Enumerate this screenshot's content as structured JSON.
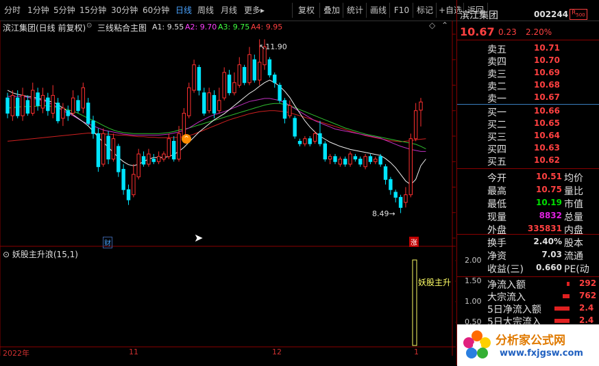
{
  "toolbar": {
    "periods": [
      "分时",
      "1分钟",
      "5分钟",
      "15分钟",
      "30分钟",
      "60分钟",
      "日线",
      "周线",
      "月线",
      "更多"
    ],
    "active_period": "日线",
    "more_arrow": "▸",
    "buttons": [
      "复权",
      "叠加",
      "统计",
      "画线",
      "F10",
      "标记",
      "+自选",
      "返回"
    ]
  },
  "chart_header": {
    "stock_title": "滨江集团(日线 前复权)",
    "indicator_name": "三线粘合主图",
    "a1": "A1: 9.55",
    "a2": "A2: 9.70",
    "a3": "A3: 9.75",
    "a4": "A4: 9.95"
  },
  "annotations": {
    "high": "11.90",
    "low": "8.49",
    "cai_badge": "财",
    "zhang_badge": "涨"
  },
  "sub_panel": {
    "title": "妖股主升浪(15,1)",
    "signal_text": "妖股主升",
    "ticks": [
      "2.00",
      "1.50",
      "1.00",
      "0.50"
    ]
  },
  "date_axis": [
    "2022年",
    "11",
    "12",
    "1"
  ],
  "quote": {
    "name": "滨江集团",
    "code": "002244",
    "badge": "R",
    "badge_num": "500",
    "price": "10.67",
    "change": "0.23",
    "pct": "2.20%",
    "asks": [
      {
        "label": "卖五",
        "price": "10.71"
      },
      {
        "label": "卖四",
        "price": "10.70"
      },
      {
        "label": "卖三",
        "price": "10.69"
      },
      {
        "label": "卖二",
        "price": "10.68"
      },
      {
        "label": "卖一",
        "price": "10.67"
      }
    ],
    "bids": [
      {
        "label": "买一",
        "price": "10.66"
      },
      {
        "label": "买二",
        "price": "10.65"
      },
      {
        "label": "买三",
        "price": "10.64"
      },
      {
        "label": "买四",
        "price": "10.63"
      },
      {
        "label": "买五",
        "price": "10.62"
      }
    ],
    "stats": [
      {
        "k": "今开",
        "v": "10.51",
        "k2": "均价",
        "color": "#ff4040"
      },
      {
        "k": "最高",
        "v": "10.75",
        "k2": "量比",
        "color": "#ff4040"
      },
      {
        "k": "最低",
        "v": "10.19",
        "k2": "市值",
        "color": "#00e000"
      },
      {
        "k": "现量",
        "v": "8832",
        "k2": "总量",
        "color": "#e020e0"
      },
      {
        "k": "外盘",
        "v": "335831",
        "k2": "内盘",
        "color": "#ff4040"
      }
    ],
    "stats2": [
      {
        "k": "换手",
        "v": "2.40%",
        "k2": "股本"
      },
      {
        "k": "净资",
        "v": "7.03",
        "k2": "流通"
      },
      {
        "k": "收益(三)",
        "v": "0.660",
        "k2": "PE(动"
      }
    ],
    "flows": [
      {
        "k": "净流入额",
        "v": "292"
      },
      {
        "k": "大宗流入",
        "v": "762"
      },
      {
        "k": "5日净流入额",
        "v": "2.4"
      },
      {
        "k": "5日大宗流入",
        "v": "2.4"
      }
    ]
  },
  "watermark": {
    "title": "分析家公式网",
    "url": "www.fxjgsw.com"
  },
  "chart_data": {
    "type": "candlestick",
    "yticks": [
      "12.00",
      "11.50",
      "11.00",
      "10.50",
      "10.00",
      "9.50",
      "9.00",
      "8.50",
      "8.00"
    ],
    "ylim": [
      8.0,
      12.0
    ],
    "candles": [
      [
        10.75,
        10.45,
        10.85,
        10.35
      ],
      [
        10.4,
        10.8,
        10.9,
        10.3
      ],
      [
        10.75,
        10.4,
        10.9,
        10.35
      ],
      [
        10.4,
        10.8,
        10.95,
        10.3
      ],
      [
        10.7,
        10.45,
        10.8,
        10.4
      ],
      [
        10.45,
        10.9,
        11.05,
        10.4
      ],
      [
        10.85,
        10.6,
        10.95,
        10.5
      ],
      [
        10.55,
        10.8,
        10.95,
        10.45
      ],
      [
        10.75,
        10.5,
        10.85,
        10.4
      ],
      [
        10.45,
        10.8,
        11.0,
        10.35
      ],
      [
        10.65,
        10.3,
        10.75,
        10.25
      ],
      [
        10.35,
        10.55,
        10.65,
        10.2
      ],
      [
        10.5,
        10.4,
        10.6,
        10.3
      ],
      [
        10.45,
        10.75,
        10.9,
        10.4
      ],
      [
        10.7,
        10.5,
        10.8,
        10.45
      ],
      [
        10.55,
        10.95,
        11.05,
        10.45
      ],
      [
        10.65,
        10.25,
        10.75,
        10.2
      ],
      [
        10.3,
        10.05,
        10.4,
        9.95
      ],
      [
        10.05,
        9.4,
        10.15,
        9.3
      ],
      [
        9.45,
        10.05,
        10.15,
        9.4
      ],
      [
        10.0,
        9.55,
        10.1,
        9.45
      ],
      [
        9.55,
        9.95,
        10.05,
        9.5
      ],
      [
        9.8,
        9.3,
        9.85,
        9.2
      ],
      [
        9.35,
        8.95,
        9.45,
        8.85
      ],
      [
        8.95,
        8.75,
        9.05,
        8.65
      ],
      [
        8.85,
        9.25,
        9.45,
        8.8
      ],
      [
        9.2,
        9.65,
        9.75,
        9.15
      ],
      [
        9.6,
        9.45,
        9.7,
        9.4
      ],
      [
        9.45,
        9.65,
        9.75,
        9.4
      ],
      [
        9.55,
        9.5,
        9.65,
        9.45
      ],
      [
        9.5,
        9.6,
        9.7,
        9.45
      ],
      [
        9.55,
        9.65,
        9.7,
        9.5
      ],
      [
        9.6,
        9.95,
        10.05,
        9.55
      ],
      [
        9.9,
        9.55,
        10.0,
        9.5
      ],
      [
        9.55,
        10.05,
        10.2,
        9.5
      ],
      [
        10.0,
        10.45,
        10.55,
        9.95
      ],
      [
        10.4,
        10.95,
        11.05,
        10.35
      ],
      [
        10.9,
        11.4,
        11.5,
        10.85
      ],
      [
        11.35,
        10.9,
        11.4,
        10.8
      ],
      [
        10.85,
        10.45,
        10.95,
        10.4
      ],
      [
        10.5,
        10.85,
        10.95,
        10.45
      ],
      [
        10.8,
        10.45,
        10.9,
        10.35
      ],
      [
        10.5,
        10.7,
        10.95,
        10.45
      ],
      [
        10.75,
        11.25,
        11.35,
        10.7
      ],
      [
        11.2,
        10.85,
        11.3,
        10.8
      ],
      [
        10.85,
        11.05,
        11.25,
        10.8
      ],
      [
        11.0,
        11.4,
        11.55,
        10.95
      ],
      [
        11.35,
        11.05,
        11.4,
        11.0
      ],
      [
        11.05,
        11.6,
        11.75,
        11.0
      ],
      [
        11.5,
        11.1,
        11.6,
        11.05
      ],
      [
        11.1,
        11.45,
        11.9,
        11.0
      ],
      [
        11.4,
        11.75,
        11.9,
        11.3
      ],
      [
        11.5,
        11.2,
        11.55,
        11.15
      ],
      [
        11.2,
        11.05,
        11.25,
        10.95
      ],
      [
        11.0,
        10.7,
        11.05,
        10.65
      ],
      [
        10.7,
        10.35,
        10.75,
        10.25
      ],
      [
        10.4,
        10.6,
        10.7,
        10.35
      ],
      [
        10.35,
        10.0,
        10.4,
        9.95
      ],
      [
        9.9,
        9.85,
        9.95,
        9.8
      ],
      [
        9.85,
        9.95,
        10.0,
        9.8
      ],
      [
        9.95,
        9.85,
        10.0,
        9.8
      ],
      [
        9.9,
        10.05,
        10.1,
        9.85
      ],
      [
        10.05,
        9.85,
        10.3,
        9.8
      ],
      [
        9.85,
        9.55,
        9.9,
        9.5
      ],
      [
        9.55,
        9.6,
        9.65,
        9.45
      ],
      [
        9.6,
        9.5,
        9.65,
        9.45
      ],
      [
        9.45,
        9.55,
        9.6,
        9.4
      ],
      [
        9.55,
        9.45,
        9.6,
        9.4
      ],
      [
        9.45,
        9.65,
        9.7,
        9.4
      ],
      [
        9.6,
        9.55,
        9.65,
        9.5
      ],
      [
        9.55,
        9.45,
        9.6,
        9.4
      ],
      [
        9.4,
        9.6,
        9.65,
        9.35
      ],
      [
        9.6,
        9.5,
        9.65,
        9.45
      ],
      [
        9.5,
        9.55,
        9.6,
        9.45
      ],
      [
        9.6,
        9.45,
        9.65,
        9.4
      ],
      [
        9.4,
        9.15,
        9.45,
        9.05
      ],
      [
        9.15,
        8.95,
        9.2,
        8.85
      ],
      [
        8.9,
        8.8,
        8.95,
        8.7
      ],
      [
        8.8,
        8.6,
        8.85,
        8.49
      ],
      [
        8.7,
        8.85,
        9.0,
        8.6
      ],
      [
        8.85,
        9.95,
        10.05,
        8.8
      ],
      [
        9.95,
        10.5,
        10.65,
        9.9
      ],
      [
        10.51,
        10.67,
        10.75,
        10.19
      ]
    ],
    "ma_white": [
      10.9,
      10.85,
      10.82,
      10.8,
      10.78,
      10.77,
      10.74,
      10.72,
      10.69,
      10.67,
      10.62,
      10.55,
      10.48,
      10.42,
      10.35,
      10.28,
      10.2,
      10.1,
      9.98,
      9.88,
      9.78,
      9.68,
      9.58,
      9.5,
      9.44,
      9.42,
      9.45,
      9.5,
      9.55,
      9.58,
      9.58,
      9.58,
      9.6,
      9.64,
      9.7,
      9.78,
      9.88,
      9.98,
      10.08,
      10.16,
      10.24,
      10.32,
      10.38,
      10.44,
      10.52,
      10.6,
      10.68,
      10.76,
      10.84,
      10.9,
      10.98,
      11.05,
      11.1,
      11.05,
      10.98,
      10.88,
      10.76,
      10.6,
      10.45,
      10.3,
      10.18,
      10.08,
      10.0,
      9.94,
      9.88,
      9.84,
      9.8,
      9.77,
      9.74,
      9.72,
      9.7,
      9.68,
      9.66,
      9.64,
      9.62,
      9.56,
      9.48,
      9.38,
      9.25,
      9.12,
      9.05,
      9.15,
      9.42,
      9.55
    ],
    "ma_magenta": [
      10.78,
      10.78,
      10.78,
      10.78,
      10.76,
      10.74,
      10.72,
      10.7,
      10.66,
      10.62,
      10.56,
      10.5,
      10.45,
      10.4,
      10.34,
      10.28,
      10.24,
      10.2,
      10.16,
      10.12,
      10.1,
      10.08,
      10.06,
      10.04,
      10.03,
      10.02,
      10.02,
      10.02,
      10.02,
      10.02,
      10.02,
      10.03,
      10.04,
      10.06,
      10.08,
      10.12,
      10.16,
      10.22,
      10.28,
      10.33,
      10.38,
      10.42,
      10.45,
      10.48,
      10.52,
      10.56,
      10.6,
      10.64,
      10.68,
      10.7,
      10.72,
      10.74,
      10.74,
      10.72,
      10.7,
      10.66,
      10.6,
      10.54,
      10.48,
      10.42,
      10.36,
      10.3,
      10.26,
      10.22,
      10.18,
      10.14,
      10.12,
      10.1,
      10.08,
      10.06,
      10.04,
      10.02,
      10.0,
      9.98,
      9.96,
      9.92,
      9.88,
      9.84,
      9.8,
      9.77,
      9.74,
      9.72,
      9.7,
      9.7
    ],
    "ma_green": [
      10.55,
      10.56,
      10.57,
      10.58,
      10.58,
      10.58,
      10.59,
      10.6,
      10.59,
      10.58,
      10.56,
      10.54,
      10.52,
      10.49,
      10.45,
      10.4,
      10.35,
      10.31,
      10.26,
      10.21,
      10.16,
      10.12,
      10.09,
      10.07,
      10.06,
      10.05,
      10.05,
      10.05,
      10.05,
      10.05,
      10.05,
      10.06,
      10.07,
      10.09,
      10.12,
      10.14,
      10.16,
      10.19,
      10.22,
      10.25,
      10.28,
      10.31,
      10.34,
      10.37,
      10.4,
      10.43,
      10.46,
      10.49,
      10.52,
      10.55,
      10.58,
      10.61,
      10.63,
      10.64,
      10.64,
      10.62,
      10.6,
      10.56,
      10.52,
      10.48,
      10.44,
      10.4,
      10.36,
      10.32,
      10.28,
      10.24,
      10.2,
      10.16,
      10.13,
      10.1,
      10.07,
      10.04,
      10.02,
      10.0,
      9.98,
      9.96,
      9.94,
      9.92,
      9.9,
      9.88,
      9.86,
      9.84,
      9.8,
      9.75
    ],
    "ma_red": [
      9.9,
      9.91,
      9.92,
      9.93,
      9.94,
      9.95,
      9.96,
      9.97,
      9.98,
      9.99,
      10.0,
      10.01,
      10.02,
      10.03,
      10.04,
      10.05,
      10.06,
      10.06,
      10.05,
      10.04,
      10.04,
      10.03,
      10.02,
      10.02,
      10.01,
      10.0,
      9.99,
      9.99,
      9.98,
      9.98,
      9.97,
      9.97,
      9.97,
      9.97,
      9.98,
      9.99,
      10.01,
      10.04,
      10.08,
      10.12,
      10.16,
      10.2,
      10.24,
      10.28,
      10.32,
      10.35,
      10.38,
      10.41,
      10.44,
      10.46,
      10.48,
      10.49,
      10.5,
      10.5,
      10.49,
      10.48,
      10.46,
      10.43,
      10.4,
      10.37,
      10.34,
      10.31,
      10.28,
      10.25,
      10.22,
      10.19,
      10.16,
      10.13,
      10.1,
      10.07,
      10.04,
      10.01,
      9.99,
      9.97,
      9.95,
      9.93,
      9.91,
      9.9,
      9.89,
      9.9,
      9.91,
      9.93,
      9.94,
      9.95
    ]
  }
}
